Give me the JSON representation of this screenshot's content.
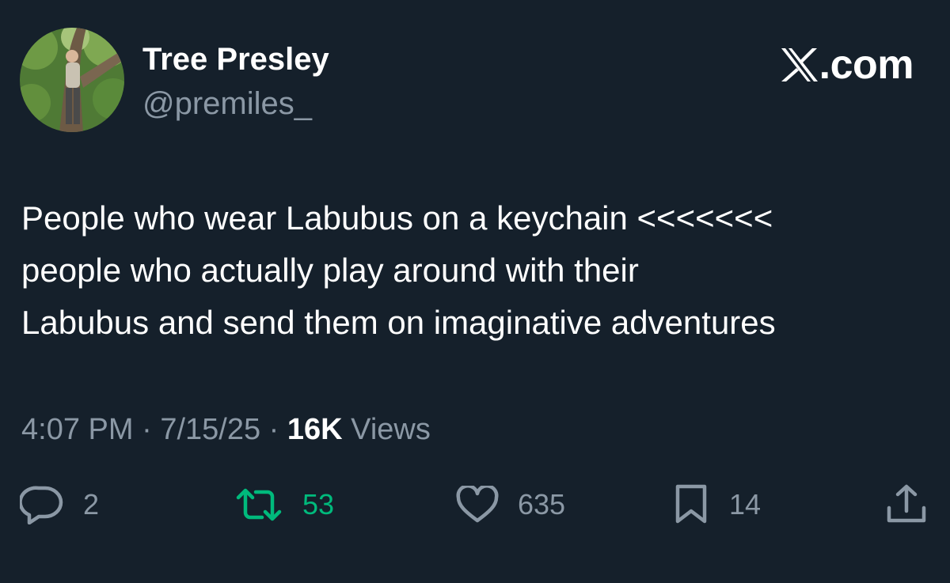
{
  "author": {
    "display_name": "Tree Presley",
    "handle": "@premiles_"
  },
  "brand": {
    "text": ".com",
    "icon": "x-logo-icon"
  },
  "tweet": {
    "text": "People who wear Labubus on a keychain <<<<<<<\npeople who actually play around with their\nLabubus and send them on imaginative adventures"
  },
  "meta": {
    "time": "4:07 PM",
    "separator": "·",
    "date": "7/15/25",
    "views_count": "16K",
    "views_label": "Views"
  },
  "actions": {
    "replies": {
      "icon": "reply-icon",
      "count": "2"
    },
    "retweets": {
      "icon": "retweet-icon",
      "count": "53",
      "color": "#00ba7c"
    },
    "likes": {
      "icon": "heart-icon",
      "count": "635"
    },
    "bookmarks": {
      "icon": "bookmark-icon",
      "count": "14"
    },
    "share": {
      "icon": "share-icon"
    }
  },
  "colors": {
    "background": "#15202b",
    "secondary_text": "#8b98a5",
    "retweet_accent": "#00ba7c"
  }
}
